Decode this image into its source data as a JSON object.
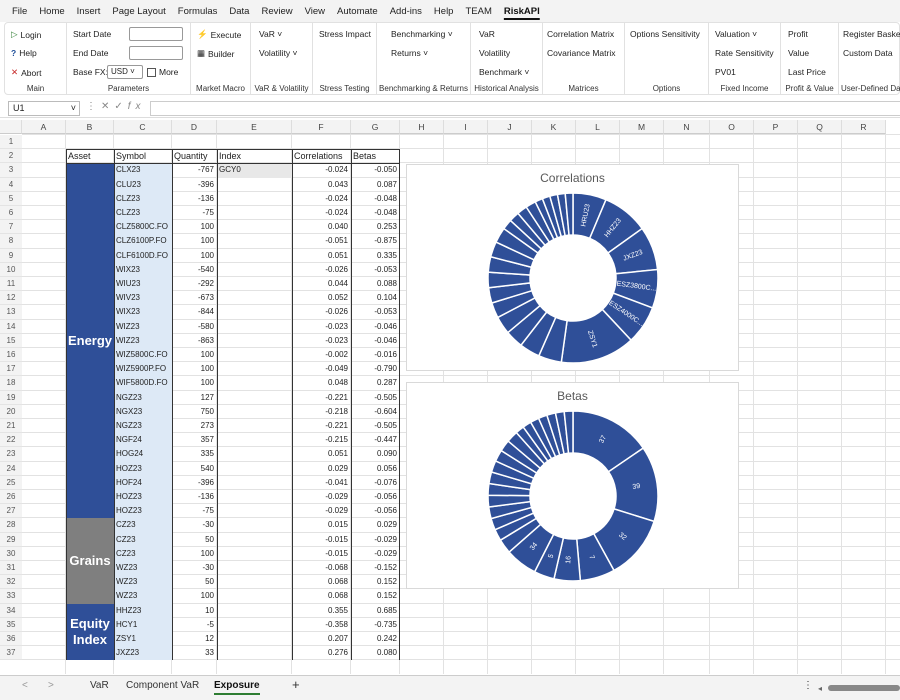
{
  "menu": [
    "File",
    "Home",
    "Insert",
    "Page Layout",
    "Formulas",
    "Data",
    "Review",
    "View",
    "Automate",
    "Add-ins",
    "Help",
    "TEAM",
    "RiskAPI"
  ],
  "ribbon": {
    "main": {
      "login": "Login",
      "help": "Help",
      "abort": "Abort",
      "label": "Main"
    },
    "parameters": {
      "start_date": "Start Date",
      "end_date": "End Date",
      "base_fx": "Base FX:",
      "fx_value": "USD",
      "more": "More",
      "label": "Parameters"
    },
    "market_macro": {
      "execute": "Execute",
      "builder": "Builder",
      "label": "Market Macro"
    },
    "var_vol": {
      "var": "VaR ˅",
      "volatility": "Volatility ˅",
      "label": "VaR & Volatility"
    },
    "stress": {
      "impact": "Stress Impact",
      "label": "Stress Testing"
    },
    "bench": {
      "benchmarking": "Benchmarking ˅",
      "returns": "Returns ˅",
      "label": "Benchmarking & Returns"
    },
    "hist": {
      "var": "VaR",
      "volatility": "Volatility",
      "benchmark": "Benchmark ˅",
      "label": "Historical Analysis"
    },
    "matrices": {
      "corr": "Correlation Matrix",
      "cov": "Covariance Matrix",
      "label": "Matrices"
    },
    "options": {
      "sens": "Options Sensitivity",
      "label": "Options"
    },
    "fixed": {
      "valuation": "Valuation ˅",
      "rate": "Rate Sensitivity",
      "pv01": "PV01",
      "label": "Fixed Income"
    },
    "profit": {
      "profit": "Profit",
      "value": "Value",
      "last": "Last Price",
      "label": "Profit & Value"
    },
    "udd": {
      "basket": "Register Basket",
      "custom": "Custom Data",
      "label": "User-Defined Data"
    }
  },
  "formula_bar": {
    "name_box": "U1",
    "fx": "fx"
  },
  "columns": [
    "A",
    "B",
    "C",
    "D",
    "E",
    "F",
    "G",
    "H",
    "I",
    "J",
    "K",
    "L",
    "M",
    "N",
    "O",
    "P",
    "Q",
    "R"
  ],
  "rows": [
    1,
    2,
    3,
    4,
    5,
    6,
    7,
    8,
    9,
    10,
    11,
    12,
    13,
    14,
    15,
    16,
    17,
    18,
    19,
    20,
    21,
    22,
    23,
    24,
    25,
    26,
    27,
    28,
    29,
    30,
    31,
    32,
    33,
    34,
    35,
    36,
    37
  ],
  "table": {
    "headers": {
      "asset": "Asset",
      "symbol": "Symbol",
      "quantity": "Quantity",
      "index": "Index",
      "correlations": "Correlations",
      "betas": "Betas"
    },
    "index_value": "GCY0",
    "groups": [
      {
        "name": "Energy",
        "color": "#2f4f98",
        "rows": 25
      },
      {
        "name": "Grains",
        "color": "#7f7f7f",
        "rows": 6
      },
      {
        "name": "Equity Index",
        "color": "#2f4f98",
        "rows": 4
      }
    ],
    "data": [
      [
        "CLX23",
        "-767",
        "-0.024",
        "-0.050"
      ],
      [
        "CLU23",
        "-396",
        "0.043",
        "0.087"
      ],
      [
        "CLZ23",
        "-136",
        "-0.024",
        "-0.048"
      ],
      [
        "CLZ23",
        "-75",
        "-0.024",
        "-0.048"
      ],
      [
        "CLZ5800C.FO",
        "100",
        "0.040",
        "0.253"
      ],
      [
        "CLZ6100P.FO",
        "100",
        "-0.051",
        "-0.875"
      ],
      [
        "CLF6100D.FO",
        "100",
        "0.051",
        "0.335"
      ],
      [
        "WIX23",
        "-540",
        "-0.026",
        "-0.053"
      ],
      [
        "WIU23",
        "-292",
        "0.044",
        "0.088"
      ],
      [
        "WIV23",
        "-673",
        "0.052",
        "0.104"
      ],
      [
        "WIX23",
        "-844",
        "-0.026",
        "-0.053"
      ],
      [
        "WIZ23",
        "-580",
        "-0.023",
        "-0.046"
      ],
      [
        "WIZ23",
        "-863",
        "-0.023",
        "-0.046"
      ],
      [
        "WIZ5800C.FO",
        "100",
        "-0.002",
        "-0.016"
      ],
      [
        "WIZ5900P.FO",
        "100",
        "-0.049",
        "-0.790"
      ],
      [
        "WIF5800D.FO",
        "100",
        "0.048",
        "0.287"
      ],
      [
        "NGZ23",
        "127",
        "-0.221",
        "-0.505"
      ],
      [
        "NGX23",
        "750",
        "-0.218",
        "-0.604"
      ],
      [
        "NGZ23",
        "273",
        "-0.221",
        "-0.505"
      ],
      [
        "NGF24",
        "357",
        "-0.215",
        "-0.447"
      ],
      [
        "HOG24",
        "335",
        "0.051",
        "0.090"
      ],
      [
        "HOZ23",
        "540",
        "0.029",
        "0.056"
      ],
      [
        "HOF24",
        "-396",
        "-0.041",
        "-0.076"
      ],
      [
        "HOZ23",
        "-136",
        "-0.029",
        "-0.056"
      ],
      [
        "HOZ23",
        "-75",
        "-0.029",
        "-0.056"
      ],
      [
        "CZ23",
        "-30",
        "0.015",
        "0.029"
      ],
      [
        "CZ23",
        "50",
        "-0.015",
        "-0.029"
      ],
      [
        "CZ23",
        "100",
        "-0.015",
        "-0.029"
      ],
      [
        "WZ23",
        "-30",
        "-0.068",
        "-0.152"
      ],
      [
        "WZ23",
        "50",
        "0.068",
        "0.152"
      ],
      [
        "WZ23",
        "100",
        "0.068",
        "0.152"
      ],
      [
        "HHZ23",
        "10",
        "0.355",
        "0.685"
      ],
      [
        "HCY1",
        "-5",
        "-0.358",
        "-0.735"
      ],
      [
        "ZSY1",
        "12",
        "0.207",
        "0.242"
      ],
      [
        "JXZ23",
        "33",
        "0.276",
        "0.080"
      ]
    ]
  },
  "charts": [
    {
      "title": "Correlations",
      "labels": [
        "HRU23",
        "HHZ23",
        "JXZ23",
        "ESZ3800C...",
        "ESZ4000C...",
        "ZSY1"
      ]
    },
    {
      "title": "Betas",
      "labels": [
        "37",
        "39",
        "32",
        "7",
        "16",
        "5",
        "34"
      ]
    }
  ],
  "tabs": [
    "VaR",
    "Component VaR",
    "Exposure"
  ],
  "active_tab": "Exposure",
  "colors": {
    "asset_blue": "#2f4f98",
    "asset_gray": "#7f7f7f",
    "symbol_bg": "#dde9f6",
    "pie": "#2f4f98"
  }
}
